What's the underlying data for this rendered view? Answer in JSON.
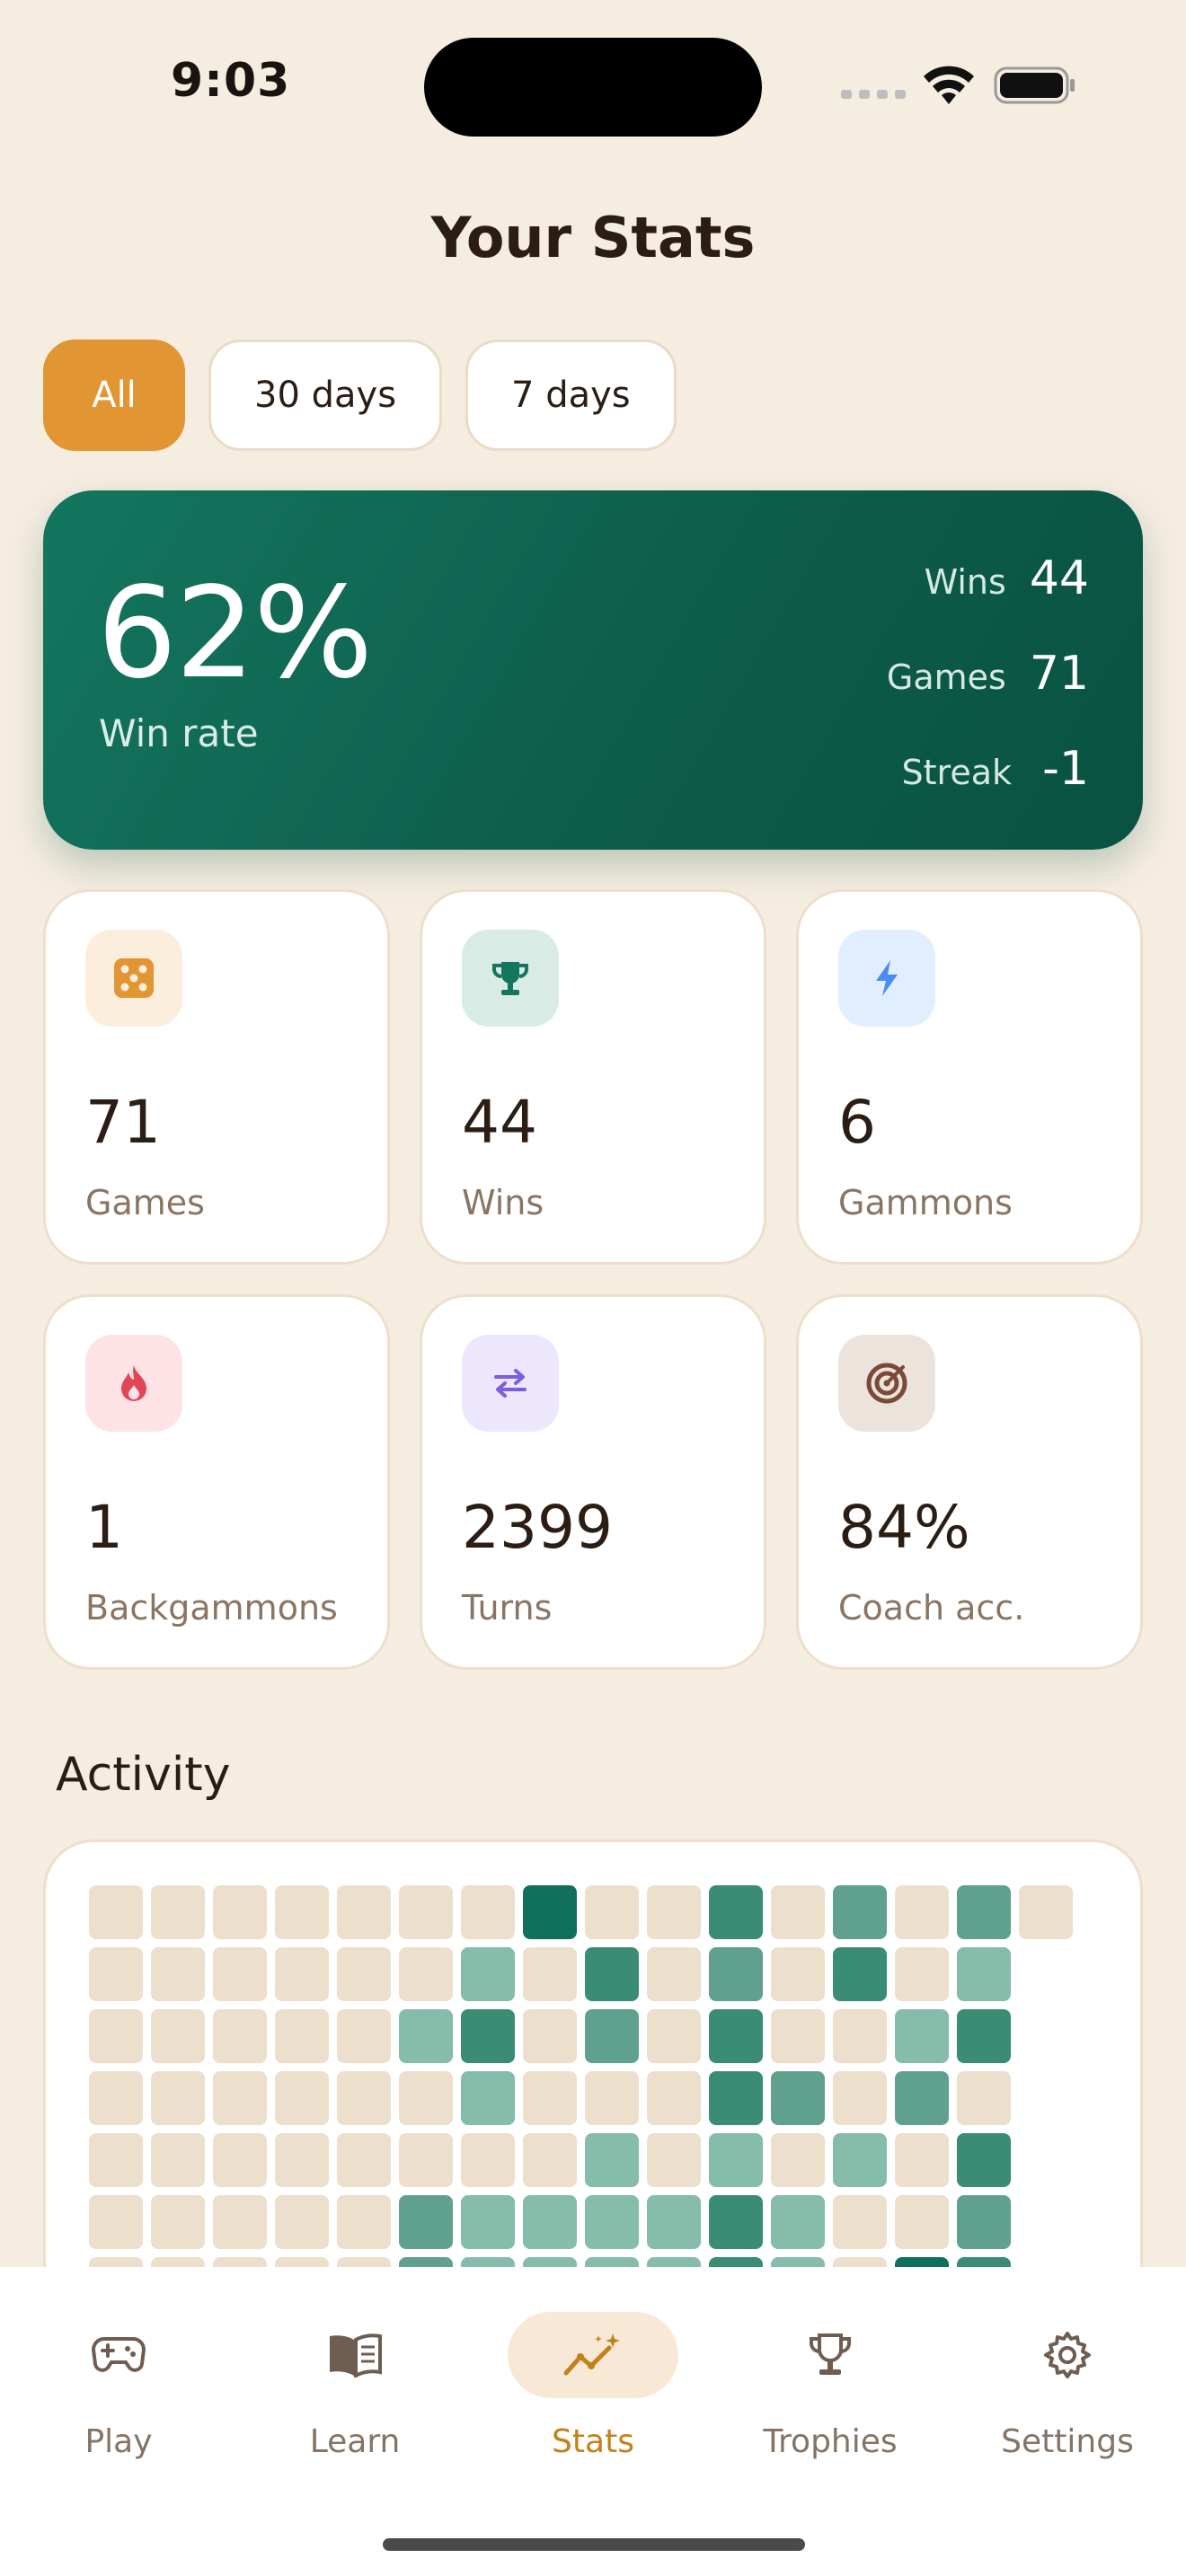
{
  "status_bar": {
    "time": "9:03"
  },
  "header": {
    "title": "Your Stats"
  },
  "filters": [
    {
      "label": "All",
      "active": true
    },
    {
      "label": "30 days",
      "active": false
    },
    {
      "label": "7 days",
      "active": false
    }
  ],
  "hero": {
    "win_rate": "62%",
    "win_rate_label": "Win rate",
    "rows": [
      {
        "label": "Wins",
        "value": "44"
      },
      {
        "label": "Games",
        "value": "71"
      },
      {
        "label": "Streak",
        "value": "-1"
      }
    ]
  },
  "stats": [
    {
      "value": "71",
      "label": "Games",
      "icon": "dice-icon",
      "icon_bg": "#fbeedd",
      "icon_color": "#e19533"
    },
    {
      "value": "44",
      "label": "Wins",
      "icon": "trophy-icon",
      "icon_bg": "#d9ebe5",
      "icon_color": "#14765f"
    },
    {
      "value": "6",
      "label": "Gammons",
      "icon": "lightning-icon",
      "icon_bg": "#e1eeff",
      "icon_color": "#4b8cf0"
    },
    {
      "value": "1",
      "label": "Backgammons",
      "icon": "flame-icon",
      "icon_bg": "#fde3e6",
      "icon_color": "#e24557"
    },
    {
      "value": "2399",
      "label": "Turns",
      "icon": "swap-arrows-icon",
      "icon_bg": "#ece7fd",
      "icon_color": "#7c5ce0"
    },
    {
      "value": "84%",
      "label": "Coach acc.",
      "icon": "target-icon",
      "icon_bg": "#ece3dc",
      "icon_color": "#7a4a38"
    }
  ],
  "activity": {
    "title": "Activity",
    "levels": [
      [
        0,
        0,
        0,
        0,
        0,
        0,
        0,
        4,
        0,
        0,
        3,
        0,
        2,
        0,
        2,
        0
      ],
      [
        0,
        0,
        0,
        0,
        0,
        0,
        1,
        0,
        3,
        0,
        2,
        0,
        3,
        0,
        1
      ],
      [
        0,
        0,
        0,
        0,
        0,
        1,
        3,
        0,
        2,
        0,
        3,
        0,
        0,
        1,
        3
      ],
      [
        0,
        0,
        0,
        0,
        0,
        0,
        1,
        0,
        0,
        0,
        3,
        2,
        0,
        2,
        0
      ],
      [
        0,
        0,
        0,
        0,
        0,
        0,
        0,
        0,
        1,
        0,
        1,
        0,
        1,
        0,
        3
      ],
      [
        0,
        0,
        0,
        0,
        0,
        2,
        1,
        1,
        1,
        1,
        3,
        1,
        0,
        0,
        2
      ],
      [
        0,
        0,
        0,
        0,
        0,
        2,
        1,
        1,
        1,
        1,
        3,
        1,
        0,
        4,
        3
      ]
    ],
    "colors": [
      "#ecdfcb",
      "#86bcaa",
      "#5fa18e",
      "#3a8c75",
      "#10705a"
    ]
  },
  "nav": [
    {
      "label": "Play",
      "icon": "gamepad-icon",
      "active": false
    },
    {
      "label": "Learn",
      "icon": "book-icon",
      "active": false
    },
    {
      "label": "Stats",
      "icon": "chart-sparkle-icon",
      "active": true
    },
    {
      "label": "Trophies",
      "icon": "trophy-icon",
      "active": false
    },
    {
      "label": "Settings",
      "icon": "gear-icon",
      "active": false
    }
  ]
}
